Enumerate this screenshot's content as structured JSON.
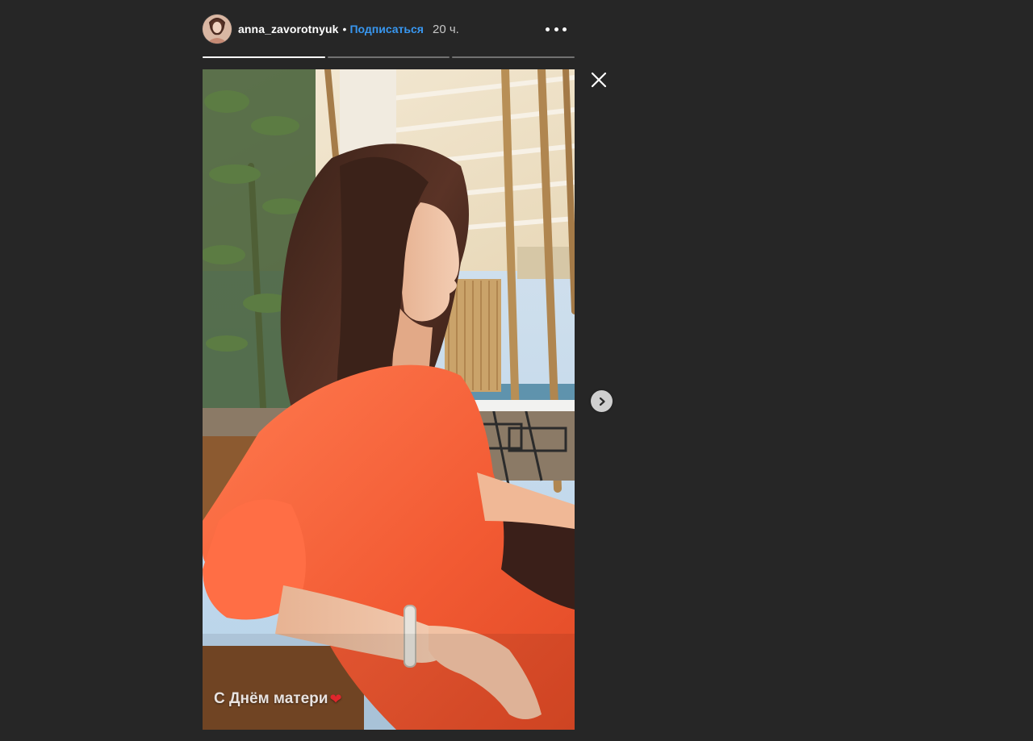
{
  "header": {
    "username": "anna_zavorotnyuk",
    "separator": "•",
    "follow_label": "Подписаться",
    "time_ago": "20 ч.",
    "avatar_icon": "profile-avatar",
    "more_icon": "more-options-icon"
  },
  "progress": {
    "segments": [
      {
        "fraction_complete": 1.0
      },
      {
        "fraction_complete": 0.0
      },
      {
        "fraction_complete": 0.0
      }
    ]
  },
  "story": {
    "caption": "С Днём матери",
    "caption_emoji": "❤",
    "image_description_icon": "story-photo"
  },
  "controls": {
    "close_icon": "close-icon",
    "next_icon": "chevron-right-icon"
  },
  "colors": {
    "background": "#262626",
    "accent": "#3897f0",
    "text": "#ffffff"
  }
}
